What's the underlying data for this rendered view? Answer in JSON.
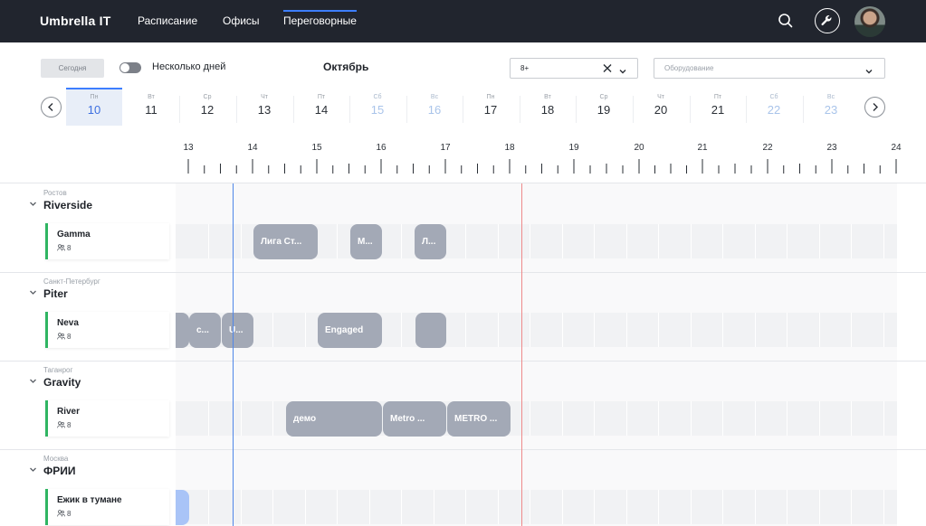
{
  "header": {
    "brand": "Umbrella IT",
    "nav": [
      "Расписание",
      "Офисы",
      "Переговорные"
    ],
    "active_nav": "Переговорные",
    "icons": [
      "search-icon",
      "wrench-icon",
      "avatar"
    ]
  },
  "filters": {
    "today_label": "Сегодня",
    "multi_days_label": "Несколько дней",
    "multi_days_on": false,
    "month": "Октябрь",
    "capacity_value": "8+",
    "equipment_placeholder": "Оборудование"
  },
  "days": [
    {
      "dn": "Пн",
      "dd": "10",
      "selected": true,
      "weekend": false
    },
    {
      "dn": "Вт",
      "dd": "11",
      "selected": false,
      "weekend": false
    },
    {
      "dn": "Ср",
      "dd": "12",
      "selected": false,
      "weekend": false
    },
    {
      "dn": "Чт",
      "dd": "13",
      "selected": false,
      "weekend": false
    },
    {
      "dn": "Пт",
      "dd": "14",
      "selected": false,
      "weekend": false
    },
    {
      "dn": "Сб",
      "dd": "15",
      "selected": false,
      "weekend": true
    },
    {
      "dn": "Вс",
      "dd": "16",
      "selected": false,
      "weekend": true
    },
    {
      "dn": "Пн",
      "dd": "17",
      "selected": false,
      "weekend": false
    },
    {
      "dn": "Вт",
      "dd": "18",
      "selected": false,
      "weekend": false
    },
    {
      "dn": "Ср",
      "dd": "19",
      "selected": false,
      "weekend": false
    },
    {
      "dn": "Чт",
      "dd": "20",
      "selected": false,
      "weekend": false
    },
    {
      "dn": "Пт",
      "dd": "21",
      "selected": false,
      "weekend": false
    },
    {
      "dn": "Сб",
      "dd": "22",
      "selected": false,
      "weekend": true
    },
    {
      "dn": "Вс",
      "dd": "23",
      "selected": false,
      "weekend": true
    }
  ],
  "hours": [
    "13",
    "14",
    "15",
    "16",
    "17",
    "18",
    "19",
    "20",
    "21",
    "22",
    "23",
    "24"
  ],
  "offices": [
    {
      "city": "Ростов",
      "office": "Riverside",
      "room": {
        "name": "Gamma",
        "capacity": "8"
      },
      "events": [
        {
          "title": "Лига Ст...",
          "color": "gray"
        },
        {
          "title": "М...",
          "color": "gray"
        },
        {
          "title": "Л...",
          "color": "gray"
        }
      ]
    },
    {
      "city": "Санкт-Петербург",
      "office": "Piter",
      "room": {
        "name": "Neva",
        "capacity": "8"
      },
      "events": [
        {
          "title": "",
          "color": "gray"
        },
        {
          "title": "с...",
          "color": "gray"
        },
        {
          "title": "U...",
          "color": "gray"
        },
        {
          "title": "Engaged",
          "color": "gray"
        },
        {
          "title": "",
          "color": "gray"
        }
      ]
    },
    {
      "city": "Таганрог",
      "office": "Gravity",
      "room": {
        "name": "River",
        "capacity": "8"
      },
      "events": [
        {
          "title": "демо",
          "color": "gray"
        },
        {
          "title": "Metro ...",
          "color": "gray"
        },
        {
          "title": "METRO ...",
          "color": "gray"
        }
      ]
    },
    {
      "city": "Москва",
      "office": "ФРИИ",
      "room": {
        "name": "Ежик в тумане",
        "capacity": "8"
      },
      "events": [
        {
          "title": "",
          "color": "blue"
        }
      ]
    }
  ]
}
